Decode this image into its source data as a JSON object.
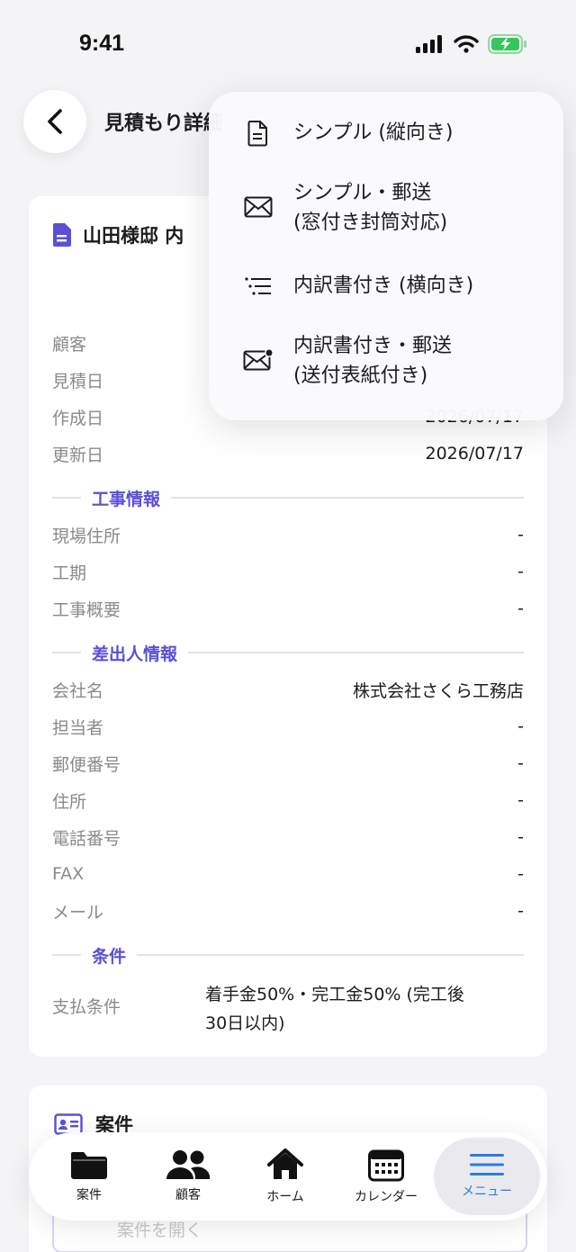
{
  "status": {
    "time": "9:41"
  },
  "header": {
    "title": "見積もり詳細"
  },
  "card": {
    "title": "山田様邸 内",
    "rows": [
      {
        "label": "顧客",
        "value": ""
      },
      {
        "label": "見積日",
        "value": ""
      },
      {
        "label": "作成日",
        "value": "2026/07/17"
      },
      {
        "label": "更新日",
        "value": "2026/07/17"
      }
    ],
    "sections": {
      "construction": "工事情報",
      "sender": "差出人情報",
      "conditions": "条件"
    },
    "construction_rows": [
      {
        "label": "現場住所",
        "value": "-"
      },
      {
        "label": "工期",
        "value": "-"
      },
      {
        "label": "工事概要",
        "value": "-"
      }
    ],
    "sender_rows": [
      {
        "label": "会社名",
        "value": "株式会社さくら工務店"
      },
      {
        "label": "担当者",
        "value": "-"
      },
      {
        "label": "郵便番号",
        "value": "-"
      },
      {
        "label": "住所",
        "value": "-"
      },
      {
        "label": "電話番号",
        "value": "-"
      },
      {
        "label": "FAX",
        "value": "-"
      },
      {
        "label": "メール",
        "value": "-"
      }
    ],
    "payment_label": "支払条件",
    "payment_value_line1": "着手金50%・完工金50% (完工後",
    "payment_value_line2": "30日以内)"
  },
  "card2": {
    "title": "案件",
    "open_label": "案件を開く"
  },
  "dropdown": {
    "items": [
      {
        "line1": "シンプル (縦向き)",
        "line2": "",
        "icon": "document-icon"
      },
      {
        "line1": "シンプル・郵送",
        "line2": "(窓付き封筒対応)",
        "icon": "envelope-icon"
      },
      {
        "line1": "内訳書付き (横向き)",
        "line2": "",
        "icon": "list-icon"
      },
      {
        "line1": "内訳書付き・郵送",
        "line2": "(送付表紙付き)",
        "icon": "envelope-badge-icon"
      }
    ]
  },
  "tabbar": {
    "items": [
      {
        "label": "案件",
        "icon": "folder-icon"
      },
      {
        "label": "顧客",
        "icon": "people-icon"
      },
      {
        "label": "ホーム",
        "icon": "home-icon"
      },
      {
        "label": "カレンダー",
        "icon": "calendar-icon"
      },
      {
        "label": "メニュー",
        "icon": "menu-icon",
        "active": true
      }
    ]
  },
  "colors": {
    "accent": "#5b4fd6",
    "tab_active": "#2a7de1",
    "battery": "#34c759"
  }
}
